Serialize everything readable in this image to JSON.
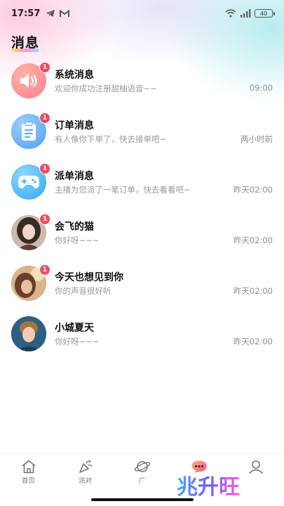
{
  "status_bar": {
    "time": "17:57",
    "battery": "40"
  },
  "page": {
    "title": "消息"
  },
  "messages": [
    {
      "name": "系统消息",
      "preview": "欢迎你成功注册甜柚语音~~",
      "time": "09:00",
      "badge": "1",
      "avatar_icon": "speaker-icon",
      "avatar_color": "#ff8a8a"
    },
    {
      "name": "订单消息",
      "preview": "有人像你下单了，快去接单吧~",
      "time": "两小时前",
      "badge": "1",
      "avatar_icon": "clipboard-icon",
      "avatar_color": "#5aa9f5"
    },
    {
      "name": "派单消息",
      "preview": "主播为您派了一笔订单，快去看看吧~",
      "time": "昨天02:00",
      "badge": "1",
      "avatar_icon": "gamepad-icon",
      "avatar_color": "#3fb3f0"
    },
    {
      "name": "会飞的猫",
      "preview": "你好呀~~~",
      "time": "昨天02:00",
      "badge": "1",
      "avatar_icon": "user-photo-avatar"
    },
    {
      "name": "今天也想见到你",
      "preview": "你的声音很好听",
      "time": "昨天02:00",
      "badge": "1",
      "avatar_icon": "user-photo-avatar"
    },
    {
      "name": "小城夏天",
      "preview": "你好呀~~~",
      "time": "昨天02:00",
      "badge": "",
      "avatar_icon": "user-photo-avatar"
    }
  ],
  "tabbar": {
    "items": [
      {
        "label": "首页",
        "icon": "home-icon"
      },
      {
        "label": "派对",
        "icon": "party-icon"
      },
      {
        "label": "广",
        "icon": "planet-icon"
      },
      {
        "label": "",
        "icon": "chat-bubble-icon"
      },
      {
        "label": "",
        "icon": "profile-icon"
      }
    ]
  },
  "watermark": {
    "text": "兆升旺"
  },
  "colors": {
    "badge": "#f24b5d",
    "secondary_text": "#9a9a9a"
  }
}
